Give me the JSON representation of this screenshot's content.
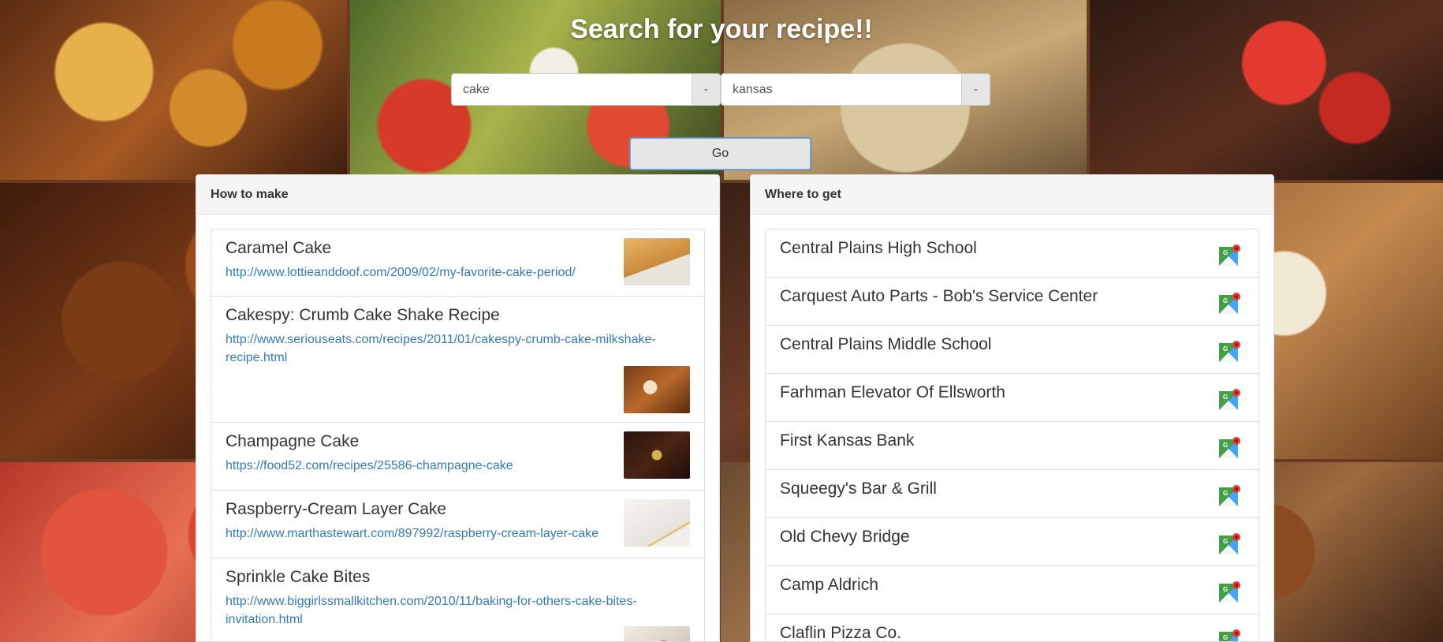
{
  "header": {
    "title": "Search for your recipe!!"
  },
  "search": {
    "recipe_value": "cake",
    "location_value": "kansas",
    "clear_label": "-",
    "go_label": "Go"
  },
  "how_to_make": {
    "heading": "How to make",
    "items": [
      {
        "title": "Caramel Cake",
        "url": "http://www.lottieanddoof.com/2009/02/my-favorite-cake-period/"
      },
      {
        "title": "Cakespy: Crumb Cake Shake Recipe",
        "url": "http://www.seriouseats.com/recipes/2011/01/cakespy-crumb-cake-milkshake-recipe.html"
      },
      {
        "title": "Champagne Cake",
        "url": "https://food52.com/recipes/25586-champagne-cake"
      },
      {
        "title": "Raspberry-Cream Layer Cake",
        "url": "http://www.marthastewart.com/897992/raspberry-cream-layer-cake"
      },
      {
        "title": "Sprinkle Cake Bites",
        "url": "http://www.biggirlssmallkitchen.com/2010/11/baking-for-others-cake-bites-invitation.html"
      }
    ]
  },
  "where_to_get": {
    "heading": "Where to get",
    "items": [
      "Central Plains High School",
      "Carquest Auto Parts - Bob's Service Center",
      "Central Plains Middle School",
      "Farhman Elevator Of Ellsworth",
      "First Kansas Bank",
      "Squeegy's Bar & Grill",
      "Old Chevy Bridge",
      "Camp Aldrich",
      "Claflin Pizza Co."
    ]
  },
  "colors": {
    "link": "#337ab7",
    "heading_bg": "#f5f5f5",
    "title_text": "#ffffff"
  }
}
